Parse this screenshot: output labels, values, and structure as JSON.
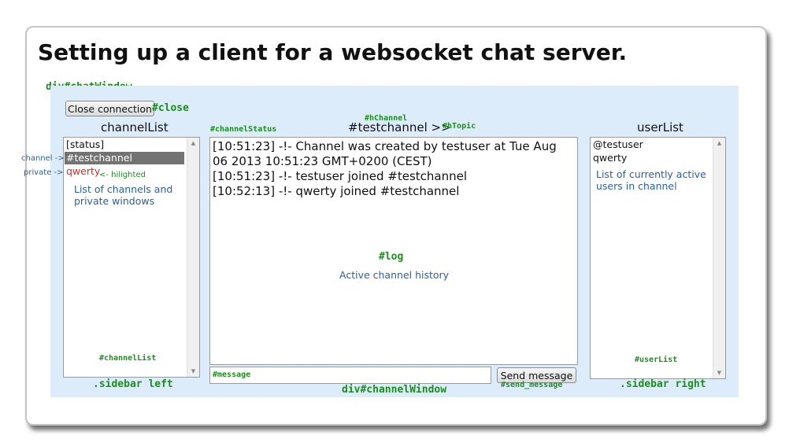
{
  "page": {
    "title": "Setting up a client for a websocket chat server."
  },
  "annotations": {
    "chat_window": "div#chatWindow",
    "close": "#close",
    "h_channel": "#hChannel",
    "channel_status": "#channelStatus",
    "h_topic": "#hTopic",
    "channel_arrow": "channel ->",
    "private_arrow": "private ->",
    "hilighted": "<- hilighted",
    "channel_list_id": "#channelList",
    "sidebar_left": ".sidebar left",
    "log_id": "#log",
    "message_id": "#message",
    "channel_window": "div#channelWindow",
    "send_message_id": "#send_message",
    "user_list_id": "#userList",
    "sidebar_right": ".sidebar right"
  },
  "notes": {
    "channels": "List of channels and private windows",
    "log": "Active channel history",
    "users": "List of currently active users in channel"
  },
  "controls": {
    "close_label": "Close connection",
    "send_label": "Send message"
  },
  "left_sidebar": {
    "header": "channelList",
    "items": [
      {
        "label": "[status]"
      },
      {
        "label": "#testchannel"
      },
      {
        "label": "qwerty"
      }
    ]
  },
  "channel": {
    "header": "#testchannel >>",
    "log": [
      "[10:51:23] -!- Channel was created by testuser at Tue Aug 06 2013 10:51:23 GMT+0200 (CEST)",
      "[10:51:23] -!- testuser joined #testchannel",
      "[10:52:13] -!- qwerty joined #testchannel"
    ]
  },
  "right_sidebar": {
    "header": "userList",
    "users": [
      "@testuser",
      "qwerty"
    ]
  },
  "colors": {
    "panel_bg": "#dcecfb",
    "annotation": "#1a8f1a",
    "note": "#2a5f9e",
    "selected_bg": "#737373",
    "hilight": "#d42a2a"
  }
}
